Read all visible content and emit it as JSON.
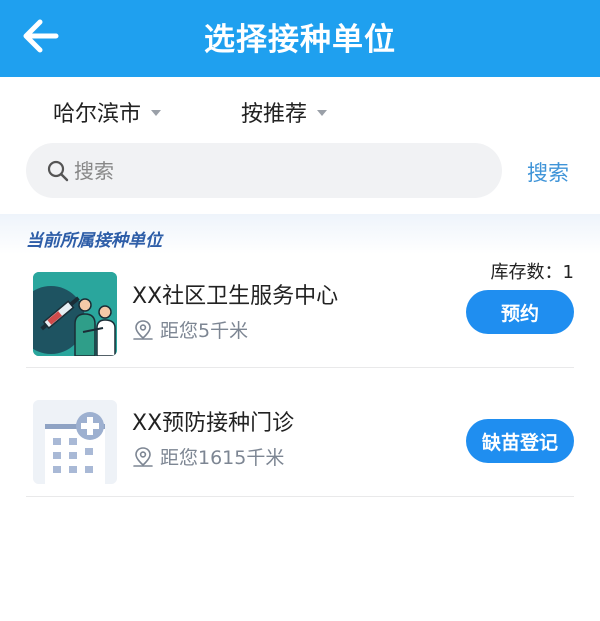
{
  "header": {
    "title": "选择接种单位",
    "back_icon": "arrow-left-icon"
  },
  "filters": {
    "city": {
      "value": "哈尔滨市"
    },
    "sort": {
      "value": "按推荐"
    }
  },
  "search": {
    "placeholder": "搜索",
    "button_label": "搜索"
  },
  "section": {
    "title": "当前所属接种单位"
  },
  "units": [
    {
      "name": "XX社区卫生服务中心",
      "distance": "距您5千米",
      "stock": "库存数：1",
      "action_label": "预约",
      "thumb_icon": "vaccination-icon"
    },
    {
      "name": "XX预防接种门诊",
      "distance": "距您1615千米",
      "action_label": "缺苗登记",
      "thumb_icon": "hospital-building-icon"
    }
  ],
  "colors": {
    "header_bg": "#1fa0ef",
    "accent_button": "#1f8ef0",
    "link_blue": "#3f94d8",
    "section_title": "#2e5ea8"
  }
}
